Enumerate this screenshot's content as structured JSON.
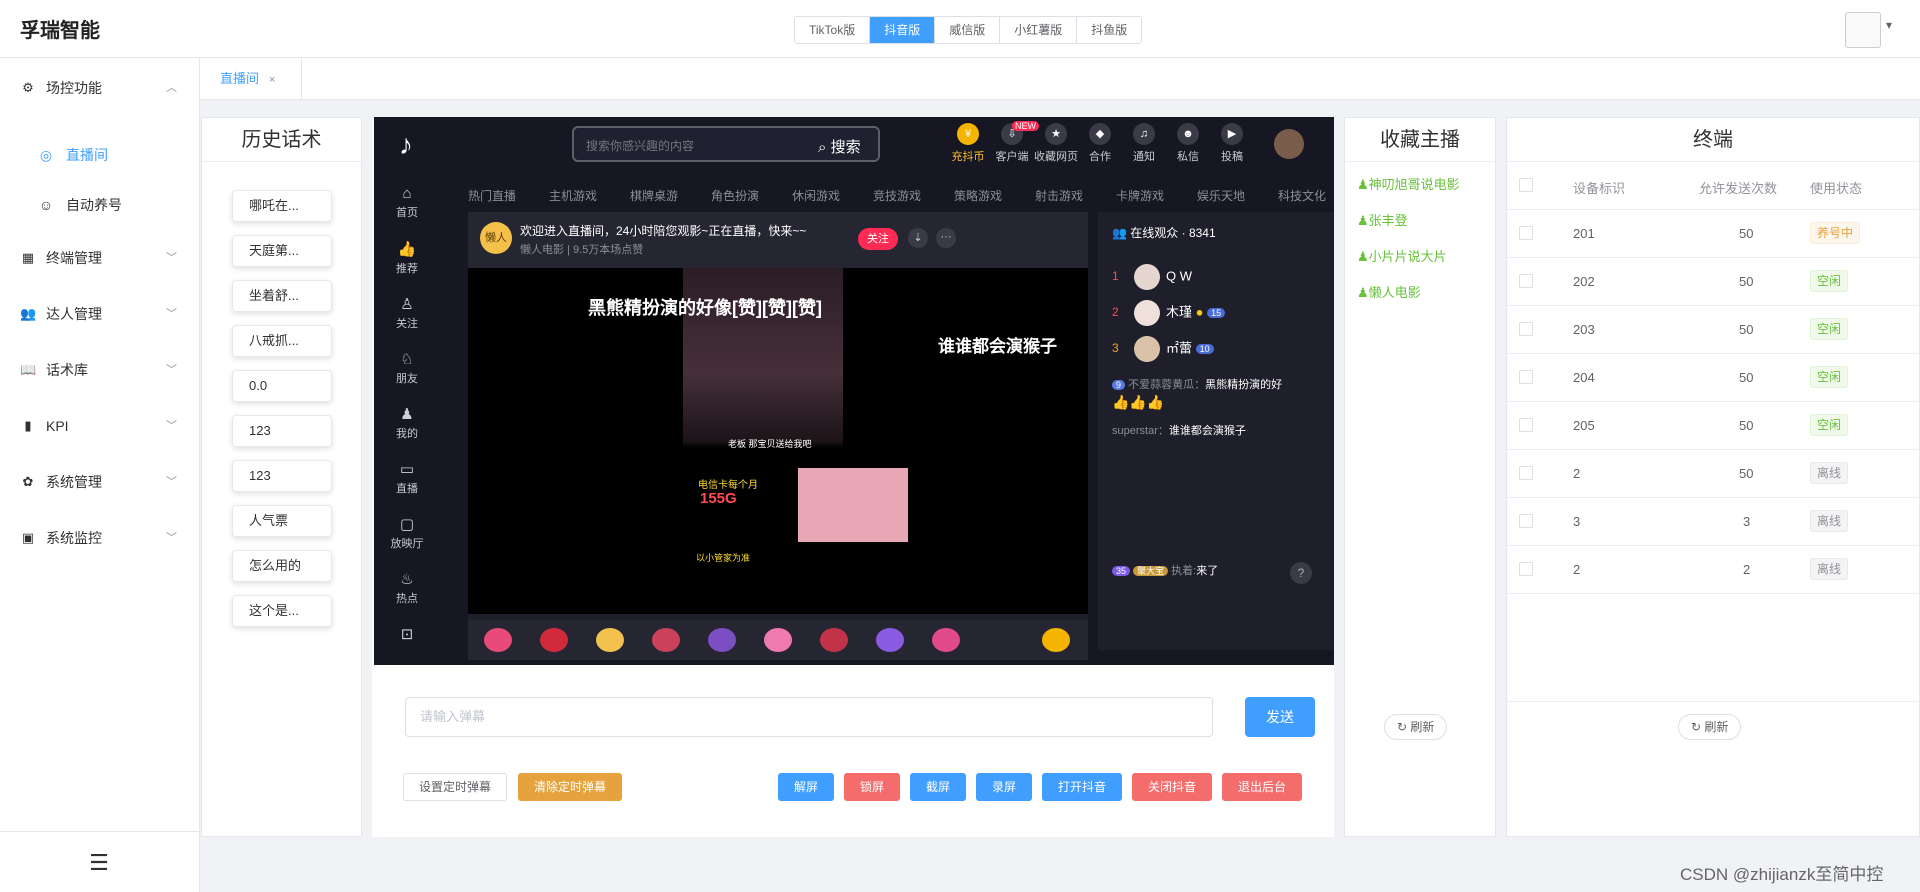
{
  "app": {
    "title": "孚瑞智能"
  },
  "version_tabs": [
    "TikTok版",
    "抖音版",
    "威信版",
    "小红薯版",
    "抖鱼版"
  ],
  "active_version_tab": "抖音版",
  "sidebar": {
    "items": [
      {
        "label": "场控功能",
        "icon": "control-icon",
        "expanded": true
      },
      {
        "label": "终端管理",
        "icon": "grid-icon"
      },
      {
        "label": "达人管理",
        "icon": "users-icon"
      },
      {
        "label": "话术库",
        "icon": "book-icon"
      },
      {
        "label": "KPI",
        "icon": "bar-chart-icon"
      },
      {
        "label": "系统管理",
        "icon": "gear-icon"
      },
      {
        "label": "系统监控",
        "icon": "monitor-icon"
      }
    ],
    "subitems": [
      {
        "label": "直播间",
        "icon": "live-icon",
        "active": true
      },
      {
        "label": "自动养号",
        "icon": "robot-icon"
      }
    ]
  },
  "page_tab": {
    "label": "直播间",
    "close": "×"
  },
  "history": {
    "title": "历史话术",
    "items": [
      "哪吒在...",
      "天庭第...",
      "坐着舒...",
      "八戒抓...",
      "0.0",
      "123",
      "123",
      "人气票",
      "怎么用的",
      "这个是..."
    ]
  },
  "douyin": {
    "search_placeholder": "搜索你感兴趣的内容",
    "search_button": "搜索",
    "top_icons": [
      "充抖币",
      "客户端",
      "收藏网页",
      "合作",
      "通知",
      "私信",
      "投稿"
    ],
    "new_badge": "NEW",
    "nav": [
      "热门直播",
      "主机游戏",
      "棋牌桌游",
      "角色扮演",
      "休闲游戏",
      "竞技游戏",
      "策略游戏",
      "射击游戏",
      "卡牌游戏",
      "娱乐天地",
      "科技文化"
    ],
    "side": [
      "首页",
      "推荐",
      "关注",
      "朋友",
      "我的",
      "直播",
      "放映厅",
      "热点"
    ],
    "room": {
      "welcome": "欢迎进入直播间，24小时陪您观影~正在直播，快来~~",
      "anchor_name": "懒人电影",
      "viewed": "9.5万本场点赞",
      "follow": "关注",
      "avatar_text": "懒人"
    },
    "video": {
      "title": "黑熊精扮演的好像[赞][赞][赞]",
      "subtitle": "谁谁都会演猴子",
      "caption": "老板 那宝贝送给我吧",
      "ad1": "电信卡每个月",
      "ad2": "155G",
      "ad3": "以小管家为准"
    },
    "chat": {
      "online_label": "在线观众 · 8341",
      "ranks": [
        {
          "rank": "1",
          "name": "Q W"
        },
        {
          "rank": "2",
          "name": "木瑾",
          "level": "15"
        },
        {
          "rank": "3",
          "name": "㎡蕾",
          "level": "10"
        }
      ],
      "messages": [
        {
          "level": "9",
          "user": "不爱蒜蓉黄瓜：",
          "text": "黑熊精扮演的好",
          "emoji": "👍👍👍"
        },
        {
          "user": "superstar：",
          "text": "谁谁都会演猴子"
        },
        {
          "level": "35",
          "badge": "聚大宝",
          "user": "执着:",
          "text": "来了"
        }
      ],
      "help": "?"
    }
  },
  "controls": {
    "danmu_placeholder": "请输入弹幕",
    "send": "发送",
    "set_timed": "设置定时弹幕",
    "clear_timed": "清除定时弹幕",
    "actions": [
      {
        "label": "解屏",
        "color": "#409eff"
      },
      {
        "label": "锁屏",
        "color": "#f56c6c"
      },
      {
        "label": "截屏",
        "color": "#409eff"
      },
      {
        "label": "录屏",
        "color": "#409eff"
      },
      {
        "label": "打开抖音",
        "color": "#409eff"
      },
      {
        "label": "关闭抖音",
        "color": "#f56c6c"
      },
      {
        "label": "退出后台",
        "color": "#f56c6c"
      }
    ]
  },
  "favorites": {
    "title": "收藏主播",
    "items": [
      "神叨旭哥说电影",
      "张丰登",
      "小片片说大片",
      "懒人电影"
    ],
    "refresh": "刷新"
  },
  "terminal": {
    "title": "终端",
    "columns": [
      "设备标识",
      "允许发送次数",
      "使用状态"
    ],
    "rows": [
      {
        "id": "201",
        "count": "50",
        "status": "养号中",
        "status_type": "warning"
      },
      {
        "id": "202",
        "count": "50",
        "status": "空闲",
        "status_type": "success"
      },
      {
        "id": "203",
        "count": "50",
        "status": "空闲",
        "status_type": "success"
      },
      {
        "id": "204",
        "count": "50",
        "status": "空闲",
        "status_type": "success"
      },
      {
        "id": "205",
        "count": "50",
        "status": "空闲",
        "status_type": "success"
      },
      {
        "id": "2",
        "count": "50",
        "status": "离线",
        "status_type": "info"
      },
      {
        "id": "3",
        "count": "3",
        "status": "离线",
        "status_type": "info"
      },
      {
        "id": "2",
        "count": "2",
        "status": "离线",
        "status_type": "info"
      }
    ],
    "refresh": "刷新"
  },
  "watermark": "CSDN @zhijianzk至简中控",
  "colors": {
    "primary": "#409eff",
    "danger": "#f56c6c",
    "warning": "#e6a23c",
    "success": "#67c23a"
  }
}
